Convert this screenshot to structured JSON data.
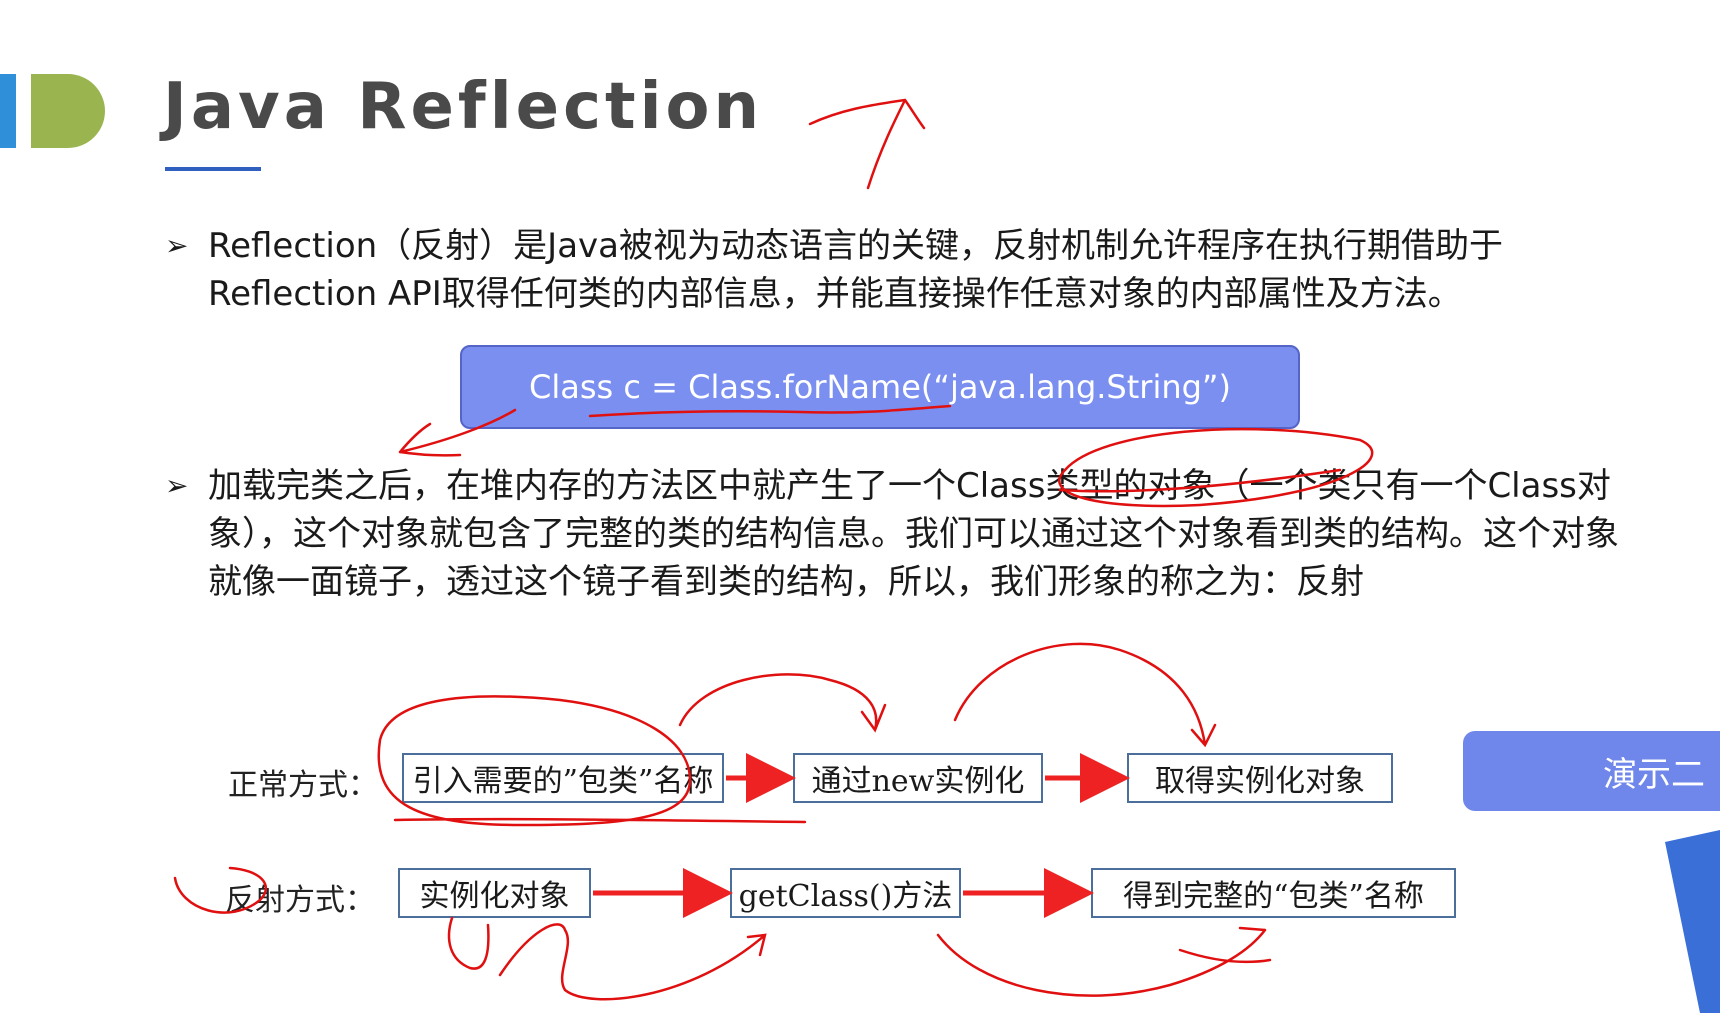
{
  "slide": {
    "title": "Java Reflection",
    "bullets": [
      "Reflection（反射）是Java被视为动态语言的关键，反射机制允许程序在执行期借助于Reflection API取得任何类的内部信息，并能直接操作任意对象的内部属性及方法。",
      "加载完类之后，在堆内存的方法区中就产生了一个Class类型的对象（一个类只有一个Class对象），这个对象就包含了完整的类的结构信息。我们可以通过这个对象看到类的结构。这个对象就像一面镜子，透过这个镜子看到类的结构，所以，我们形象的称之为：反射"
    ],
    "bullet_marker": "➢",
    "code": "Class c = Class.forName(“java.lang.String”)",
    "normal_label": "正常方式：",
    "normal_steps": [
      "引入需要的”包类”名称",
      "通过new实例化",
      "取得实例化对象"
    ],
    "reflect_label": "反射方式：",
    "reflect_steps": [
      "实例化对象",
      "getClass()方法",
      "得到完整的“包类”名称"
    ],
    "demo_button": "演示二"
  },
  "colors": {
    "title": "#4a4a4a",
    "accent_blue": "#2f8fd8",
    "accent_green": "#9ab550",
    "code_box": "#7a8ff0",
    "arrow_red": "#ee2222",
    "annotation_red": "#e01010"
  }
}
